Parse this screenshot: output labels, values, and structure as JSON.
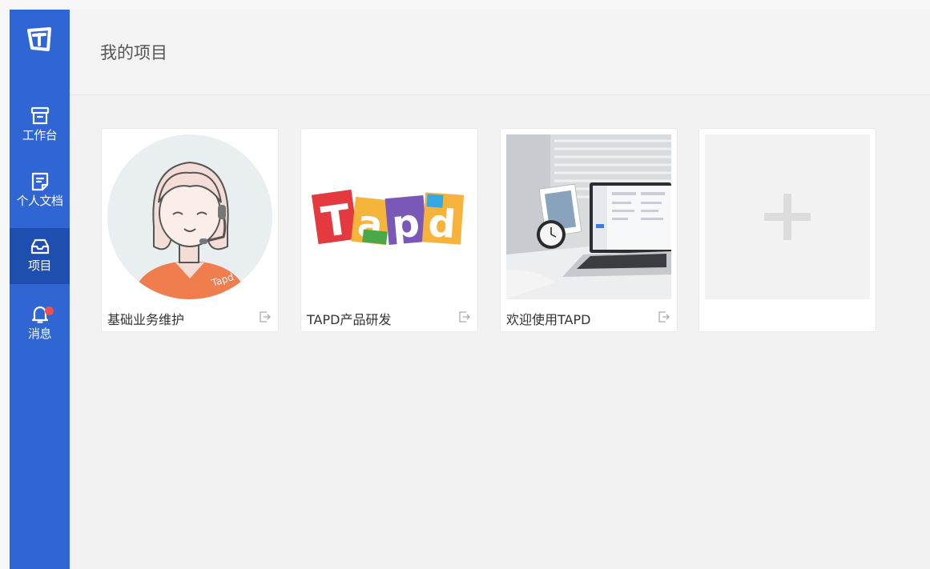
{
  "sidebar": {
    "logo": "tapd-logo",
    "items": [
      {
        "label": "工作台",
        "icon": "archive-icon",
        "active": false
      },
      {
        "label": "个人文档",
        "icon": "document-icon",
        "active": false
      },
      {
        "label": "项目",
        "icon": "inbox-icon",
        "active": true
      },
      {
        "label": "消息",
        "icon": "bell-icon",
        "active": false,
        "badge": true
      }
    ]
  },
  "header": {
    "title": "我的项目"
  },
  "projects": [
    {
      "name": "基础业务维护",
      "thumbnail": "avatar-girl-headset",
      "exit_icon": "exit-icon"
    },
    {
      "name": "TAPD产品研发",
      "thumbnail": "tapd-logo-colorful",
      "exit_icon": "exit-icon"
    },
    {
      "name": "欢迎使用TAPD",
      "thumbnail": "desk-laptop-photo",
      "exit_icon": "exit-icon"
    }
  ],
  "add_card": {
    "icon": "plus-icon"
  },
  "colors": {
    "sidebar": "#2f66d3",
    "sidebar_active": "#1e4fb0",
    "badge": "#f24d4d",
    "background": "#f2f2f2"
  }
}
